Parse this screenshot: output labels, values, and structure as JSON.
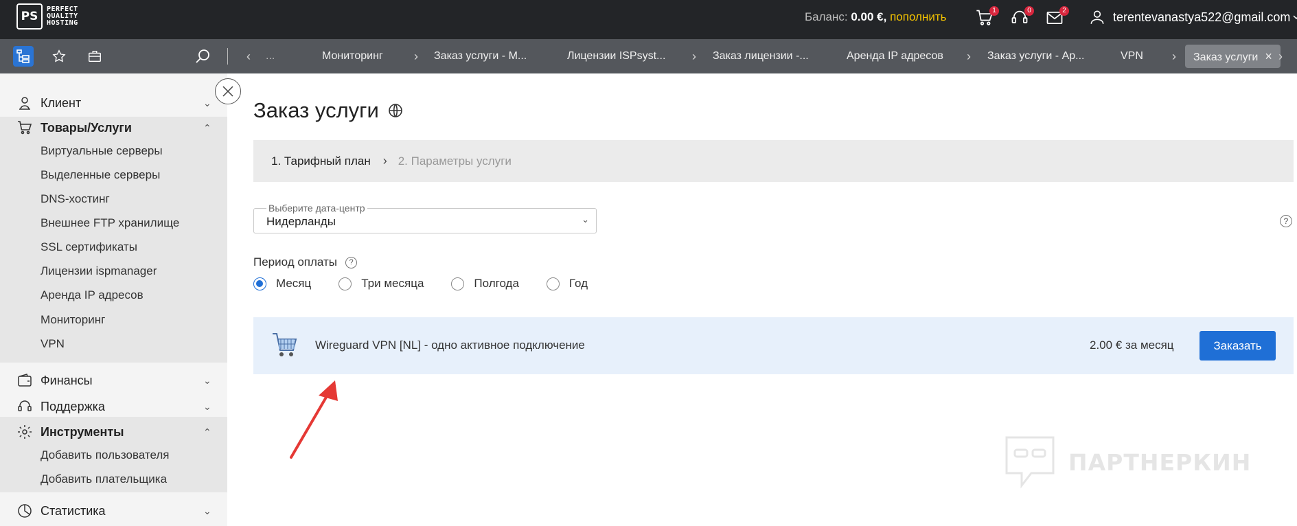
{
  "header": {
    "logo_mark": "PS",
    "logo_text": [
      "PERFECT",
      "QUALITY",
      "HOSTING"
    ],
    "balance_label": "Баланс:",
    "balance_value": "0.00 €,",
    "topup_label": "пополнить",
    "cart_count": "1",
    "support_count": "0",
    "messages_count": "2",
    "username": "terentevanastya522@gmail.com"
  },
  "tabs": {
    "overflow": "...",
    "items": [
      "Мониторинг",
      "Заказ услуги - М...",
      "Лицензии ISPsyst...",
      "Заказ лицензии -...",
      "Аренда IP адресов",
      "Заказ услуги - Ар...",
      "VPN",
      "Заказ услуги"
    ]
  },
  "sidebar": {
    "client": "Клиент",
    "goods": "Товары/Услуги",
    "goods_items": [
      "Виртуальные серверы",
      "Выделенные серверы",
      "DNS-хостинг",
      "Внешнее FTP хранилище",
      "SSL сертификаты",
      "Лицензии ispmanager",
      "Аренда IP адресов",
      "Мониторинг",
      "VPN"
    ],
    "finance": "Финансы",
    "support": "Поддержка",
    "tools": "Инструменты",
    "tools_items": [
      "Добавить пользователя",
      "Добавить плательщика"
    ],
    "stats": "Статистика"
  },
  "main": {
    "title": "Заказ услуги",
    "step1": "1. Тарифный план",
    "step2": "2. Параметры услуги",
    "datacenter_label": "Выберите дата-центр",
    "datacenter_value": "Нидерланды",
    "period_label": "Период оплаты",
    "periods": [
      "Месяц",
      "Три месяца",
      "Полгода",
      "Год"
    ],
    "selected_period": "Месяц",
    "product_name": "Wireguard VPN [NL] - одно активное подключение",
    "product_price": "2.00 € за месяц",
    "order_button": "Заказать"
  },
  "watermark": "ПАРТНЕРКИН",
  "colors": {
    "topbar": "#232528",
    "tabbar": "#54575c",
    "accent": "#1f6fd6",
    "topup": "#f5c400",
    "badge": "#d7263d",
    "product_bg": "#e7f0fb",
    "arrow": "#e53935"
  }
}
